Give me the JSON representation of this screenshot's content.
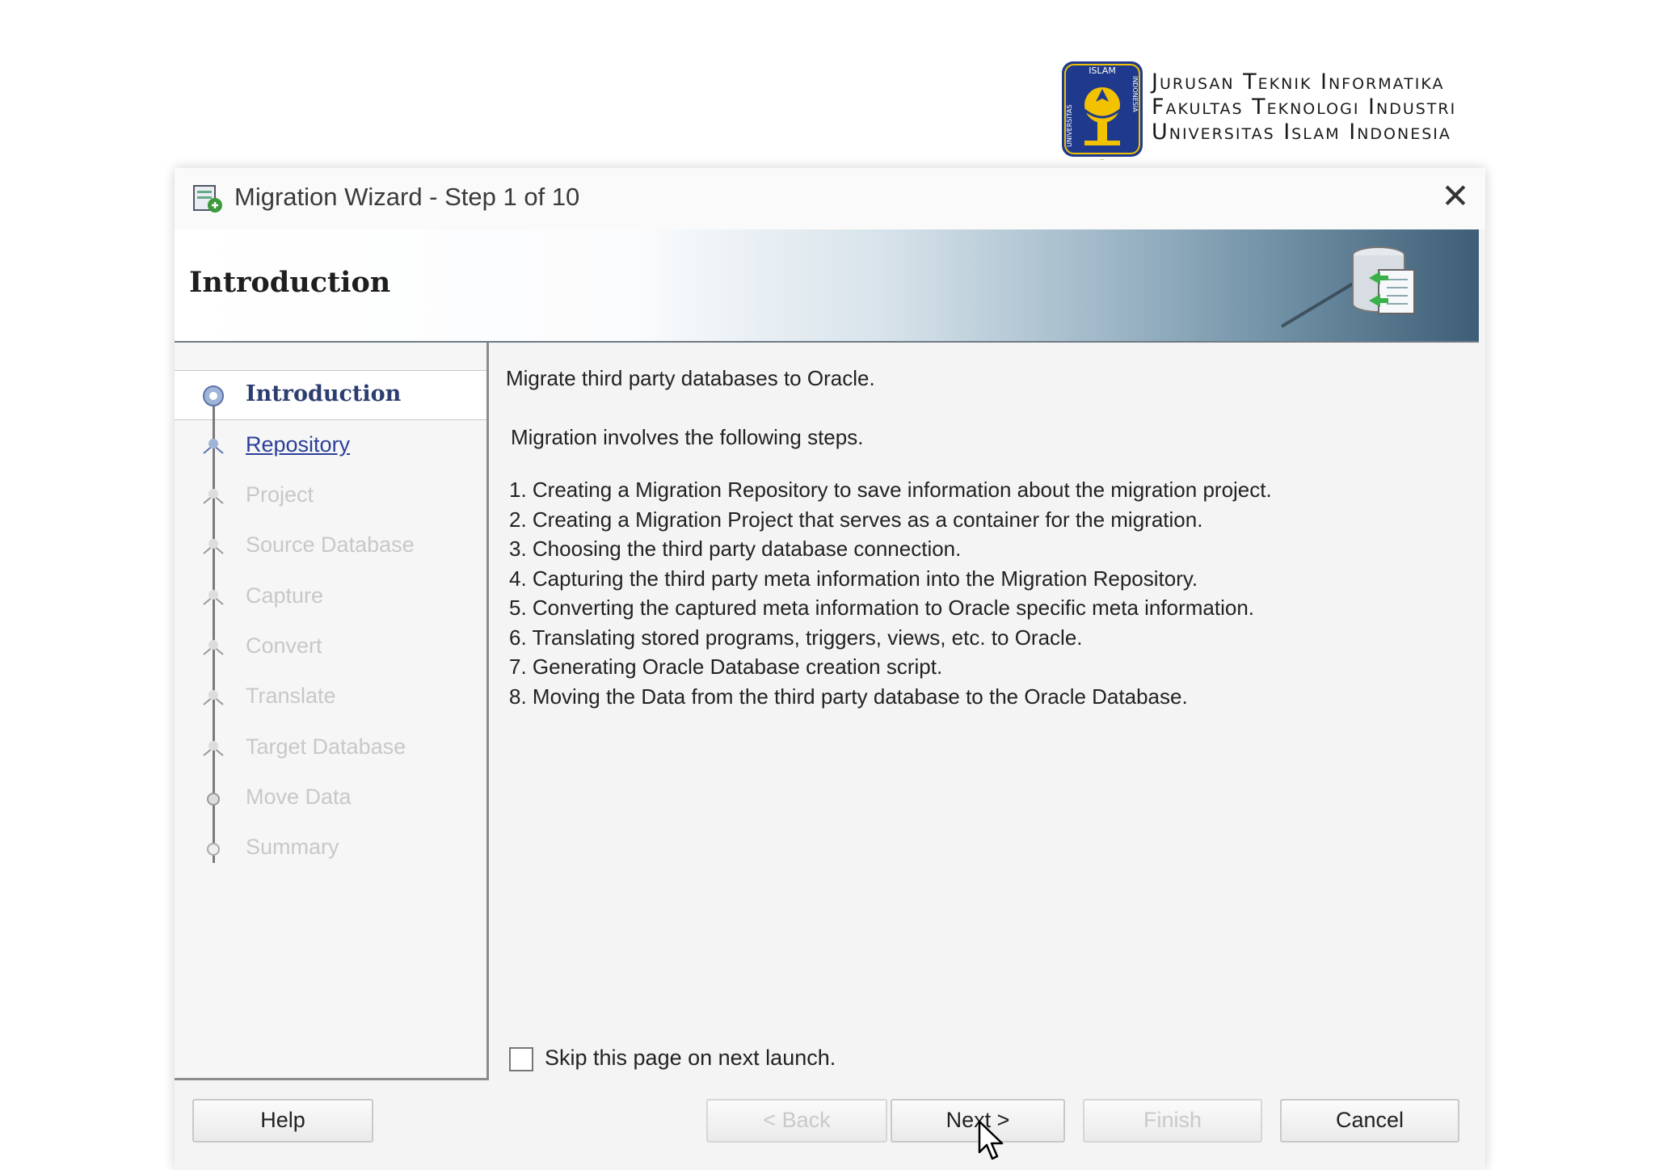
{
  "institution": {
    "lines": [
      "Jurusan Teknik Informatika",
      "Fakultas Teknologi Industri",
      "Universitas Islam Indonesia"
    ],
    "logo_text_top": "ISLAM",
    "logo_text_left": "UNIVERSITAS",
    "logo_text_right": "INDONESIA"
  },
  "window": {
    "title": "Migration Wizard - Step 1 of 10",
    "close_glyph": "✕"
  },
  "banner": {
    "title": "Introduction"
  },
  "nav": {
    "items": [
      {
        "label": "Introduction",
        "state": "current"
      },
      {
        "label": "Repository",
        "state": "link"
      },
      {
        "label": "Project",
        "state": "disabled"
      },
      {
        "label": "Source Database",
        "state": "disabled"
      },
      {
        "label": "Capture",
        "state": "disabled"
      },
      {
        "label": "Convert",
        "state": "disabled"
      },
      {
        "label": "Translate",
        "state": "disabled"
      },
      {
        "label": "Target Database",
        "state": "disabled"
      },
      {
        "label": "Move Data",
        "state": "disabled"
      },
      {
        "label": "Summary",
        "state": "disabled"
      }
    ]
  },
  "content": {
    "intro": "Migrate third party databases to Oracle.",
    "steps_heading": "Migration involves the following steps.",
    "steps": [
      "1. Creating a Migration Repository to save information about the migration project.",
      "2. Creating a Migration Project that serves as a container for the migration.",
      "3. Choosing the third party database connection.",
      "4. Capturing the third party meta information into the Migration Repository.",
      "5. Converting the captured meta information to Oracle specific meta information.",
      "6. Translating stored programs, triggers, views, etc.  to Oracle.",
      "7. Generating Oracle Database creation script.",
      "8. Moving the Data from the third party database to the Oracle Database."
    ],
    "skip_label": "Skip this page on next launch.",
    "skip_checked": false
  },
  "buttons": {
    "help": "Help",
    "back": "< Back",
    "next": "Next >",
    "finish": "Finish",
    "cancel": "Cancel"
  },
  "colors": {
    "link": "#2b3f9a",
    "current": "#2c3e70",
    "disabled": "#c8c8c8",
    "logo_blue": "#1f3a8c",
    "logo_gold": "#f2c200"
  }
}
